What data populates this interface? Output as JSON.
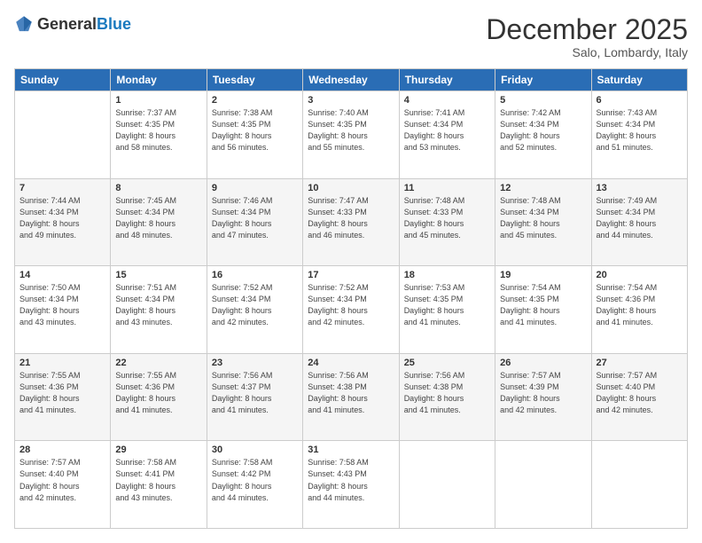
{
  "logo": {
    "general": "General",
    "blue": "Blue"
  },
  "title": "December 2025",
  "subtitle": "Salo, Lombardy, Italy",
  "days_header": [
    "Sunday",
    "Monday",
    "Tuesday",
    "Wednesday",
    "Thursday",
    "Friday",
    "Saturday"
  ],
  "weeks": [
    [
      {
        "day": "",
        "info": ""
      },
      {
        "day": "1",
        "info": "Sunrise: 7:37 AM\nSunset: 4:35 PM\nDaylight: 8 hours\nand 58 minutes."
      },
      {
        "day": "2",
        "info": "Sunrise: 7:38 AM\nSunset: 4:35 PM\nDaylight: 8 hours\nand 56 minutes."
      },
      {
        "day": "3",
        "info": "Sunrise: 7:40 AM\nSunset: 4:35 PM\nDaylight: 8 hours\nand 55 minutes."
      },
      {
        "day": "4",
        "info": "Sunrise: 7:41 AM\nSunset: 4:34 PM\nDaylight: 8 hours\nand 53 minutes."
      },
      {
        "day": "5",
        "info": "Sunrise: 7:42 AM\nSunset: 4:34 PM\nDaylight: 8 hours\nand 52 minutes."
      },
      {
        "day": "6",
        "info": "Sunrise: 7:43 AM\nSunset: 4:34 PM\nDaylight: 8 hours\nand 51 minutes."
      }
    ],
    [
      {
        "day": "7",
        "info": "Sunrise: 7:44 AM\nSunset: 4:34 PM\nDaylight: 8 hours\nand 49 minutes."
      },
      {
        "day": "8",
        "info": "Sunrise: 7:45 AM\nSunset: 4:34 PM\nDaylight: 8 hours\nand 48 minutes."
      },
      {
        "day": "9",
        "info": "Sunrise: 7:46 AM\nSunset: 4:34 PM\nDaylight: 8 hours\nand 47 minutes."
      },
      {
        "day": "10",
        "info": "Sunrise: 7:47 AM\nSunset: 4:33 PM\nDaylight: 8 hours\nand 46 minutes."
      },
      {
        "day": "11",
        "info": "Sunrise: 7:48 AM\nSunset: 4:33 PM\nDaylight: 8 hours\nand 45 minutes."
      },
      {
        "day": "12",
        "info": "Sunrise: 7:48 AM\nSunset: 4:34 PM\nDaylight: 8 hours\nand 45 minutes."
      },
      {
        "day": "13",
        "info": "Sunrise: 7:49 AM\nSunset: 4:34 PM\nDaylight: 8 hours\nand 44 minutes."
      }
    ],
    [
      {
        "day": "14",
        "info": "Sunrise: 7:50 AM\nSunset: 4:34 PM\nDaylight: 8 hours\nand 43 minutes."
      },
      {
        "day": "15",
        "info": "Sunrise: 7:51 AM\nSunset: 4:34 PM\nDaylight: 8 hours\nand 43 minutes."
      },
      {
        "day": "16",
        "info": "Sunrise: 7:52 AM\nSunset: 4:34 PM\nDaylight: 8 hours\nand 42 minutes."
      },
      {
        "day": "17",
        "info": "Sunrise: 7:52 AM\nSunset: 4:34 PM\nDaylight: 8 hours\nand 42 minutes."
      },
      {
        "day": "18",
        "info": "Sunrise: 7:53 AM\nSunset: 4:35 PM\nDaylight: 8 hours\nand 41 minutes."
      },
      {
        "day": "19",
        "info": "Sunrise: 7:54 AM\nSunset: 4:35 PM\nDaylight: 8 hours\nand 41 minutes."
      },
      {
        "day": "20",
        "info": "Sunrise: 7:54 AM\nSunset: 4:36 PM\nDaylight: 8 hours\nand 41 minutes."
      }
    ],
    [
      {
        "day": "21",
        "info": "Sunrise: 7:55 AM\nSunset: 4:36 PM\nDaylight: 8 hours\nand 41 minutes."
      },
      {
        "day": "22",
        "info": "Sunrise: 7:55 AM\nSunset: 4:36 PM\nDaylight: 8 hours\nand 41 minutes."
      },
      {
        "day": "23",
        "info": "Sunrise: 7:56 AM\nSunset: 4:37 PM\nDaylight: 8 hours\nand 41 minutes."
      },
      {
        "day": "24",
        "info": "Sunrise: 7:56 AM\nSunset: 4:38 PM\nDaylight: 8 hours\nand 41 minutes."
      },
      {
        "day": "25",
        "info": "Sunrise: 7:56 AM\nSunset: 4:38 PM\nDaylight: 8 hours\nand 41 minutes."
      },
      {
        "day": "26",
        "info": "Sunrise: 7:57 AM\nSunset: 4:39 PM\nDaylight: 8 hours\nand 42 minutes."
      },
      {
        "day": "27",
        "info": "Sunrise: 7:57 AM\nSunset: 4:40 PM\nDaylight: 8 hours\nand 42 minutes."
      }
    ],
    [
      {
        "day": "28",
        "info": "Sunrise: 7:57 AM\nSunset: 4:40 PM\nDaylight: 8 hours\nand 42 minutes."
      },
      {
        "day": "29",
        "info": "Sunrise: 7:58 AM\nSunset: 4:41 PM\nDaylight: 8 hours\nand 43 minutes."
      },
      {
        "day": "30",
        "info": "Sunrise: 7:58 AM\nSunset: 4:42 PM\nDaylight: 8 hours\nand 44 minutes."
      },
      {
        "day": "31",
        "info": "Sunrise: 7:58 AM\nSunset: 4:43 PM\nDaylight: 8 hours\nand 44 minutes."
      },
      {
        "day": "",
        "info": ""
      },
      {
        "day": "",
        "info": ""
      },
      {
        "day": "",
        "info": ""
      }
    ]
  ]
}
